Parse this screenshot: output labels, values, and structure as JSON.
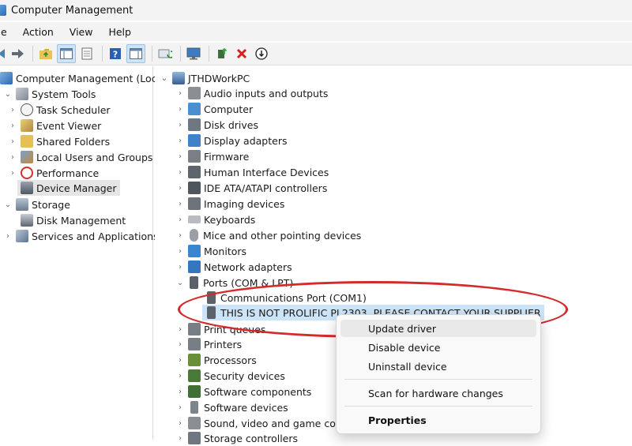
{
  "window": {
    "title": "Computer Management"
  },
  "menubar": {
    "items": [
      "ile",
      "Action",
      "View",
      "Help"
    ]
  },
  "left_tree": {
    "root": "Computer Management (Local)",
    "system_tools": "System Tools",
    "task_scheduler": "Task Scheduler",
    "event_viewer": "Event Viewer",
    "shared_folders": "Shared Folders",
    "local_users": "Local Users and Groups",
    "performance": "Performance",
    "device_manager": "Device Manager",
    "storage": "Storage",
    "disk_management": "Disk Management",
    "services": "Services and Applications"
  },
  "device_tree": {
    "root": "JTHDWorkPC",
    "categories": {
      "audio": "Audio inputs and outputs",
      "computer": "Computer",
      "disk": "Disk drives",
      "display": "Display adapters",
      "firmware": "Firmware",
      "hid": "Human Interface Devices",
      "ide": "IDE ATA/ATAPI controllers",
      "imaging": "Imaging devices",
      "keyboards": "Keyboards",
      "mice": "Mice and other pointing devices",
      "monitors": "Monitors",
      "network": "Network adapters",
      "ports": "Ports (COM & LPT)",
      "print_queues": "Print queues",
      "printers": "Printers",
      "processors": "Processors",
      "security": "Security devices",
      "software_components": "Software components",
      "software_devices": "Software devices",
      "sound": "Sound, video and game con",
      "storage": "Storage controllers"
    },
    "ports_children": {
      "com1": "Communications Port (COM1)",
      "prolific": "THIS IS NOT PROLIFIC PL2303. PLEASE CONTACT YOUR SUPPLIER"
    }
  },
  "context_menu": {
    "update": "Update driver",
    "disable": "Disable device",
    "uninstall": "Uninstall device",
    "scan": "Scan for hardware changes",
    "properties": "Properties"
  },
  "colors": {
    "annotation": "#d32b2b",
    "selection": "#cce4f7",
    "accent": "#2b6cb5"
  },
  "icons": [
    "folder-up-icon",
    "console-tree-icon",
    "properties-icon",
    "help-icon",
    "action-pane-icon",
    "refresh-icon",
    "monitor-icon",
    "update-driver-icon",
    "uninstall-icon",
    "disable-icon"
  ]
}
